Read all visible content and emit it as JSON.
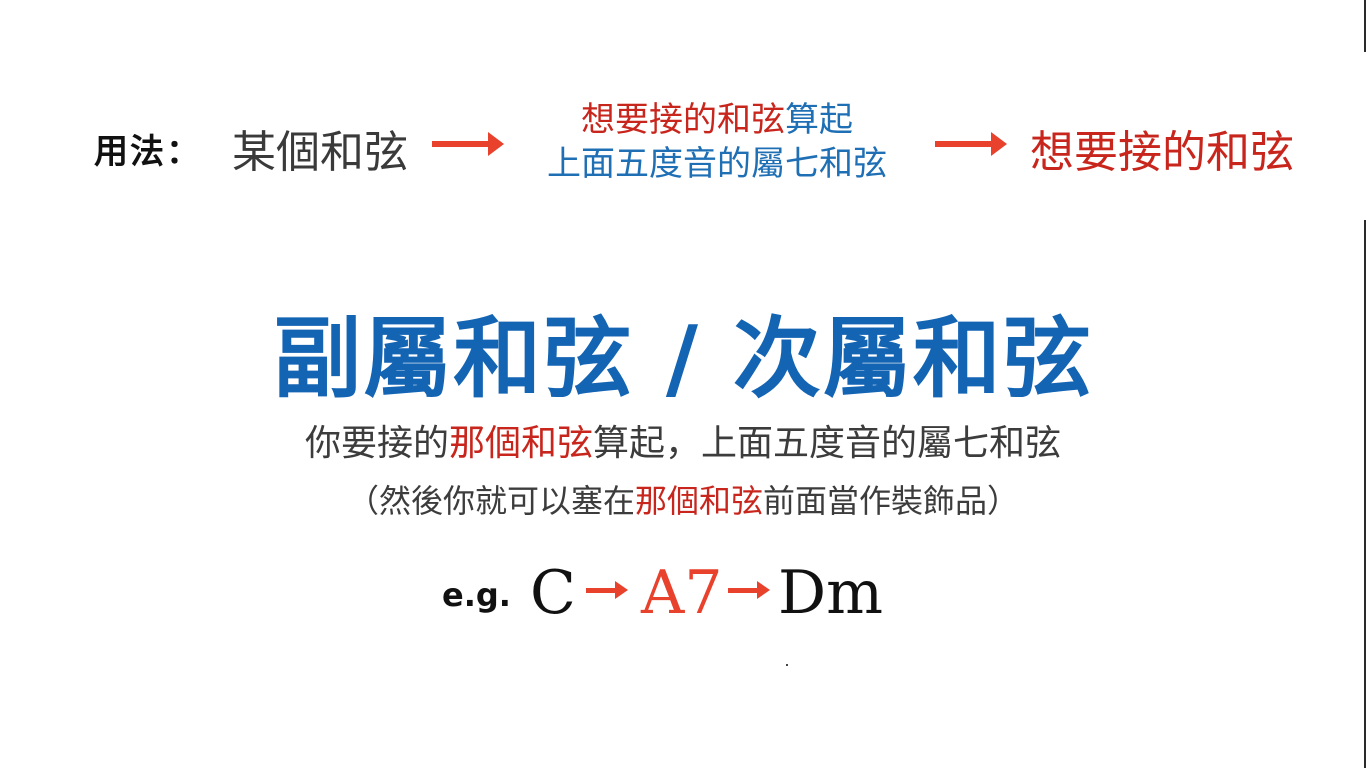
{
  "usage": {
    "label": "用法：",
    "source": "某個和弦",
    "middle": {
      "line1_red": "想要接的和弦",
      "line1_blue": "算起",
      "line2": "上面五度音的屬七和弦"
    },
    "target": "想要接的和弦"
  },
  "title": "副屬和弦 / 次屬和弦",
  "description": {
    "line1_pre": "你要接的",
    "line1_red": "那個和弦",
    "line1_post": "算起，上面五度音的屬七和弦",
    "line2_pre": "（然後你就可以塞在",
    "line2_red": "那個和弦",
    "line2_post": "前面當作裝飾品）"
  },
  "example": {
    "label": "e.g.",
    "chords": [
      "C",
      "A7",
      "Dm"
    ]
  },
  "colors": {
    "accent_blue": "#1464b4",
    "accent_red": "#c8261d",
    "arrow_red": "#e8412c"
  }
}
